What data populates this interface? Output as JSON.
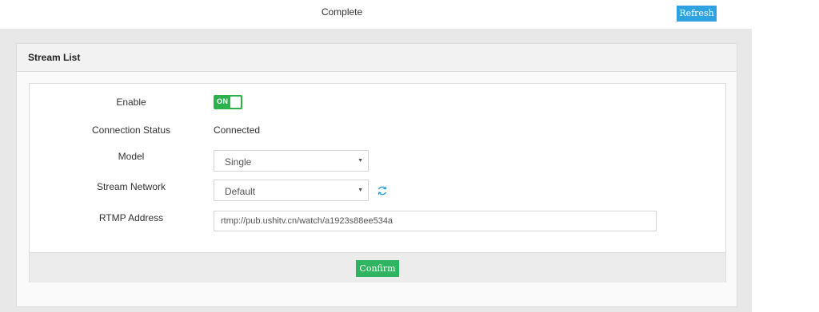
{
  "topbar": {
    "status_text": "Complete",
    "refresh_label": "Refresh"
  },
  "panel": {
    "title": "Stream List",
    "form": {
      "enable": {
        "label": "Enable",
        "toggle_text": "ON",
        "value": true
      },
      "connection_status": {
        "label": "Connection Status",
        "value": "Connected"
      },
      "model": {
        "label": "Model",
        "selected": "Single"
      },
      "stream_network": {
        "label": "Stream Network",
        "selected": "Default",
        "refresh_icon": "refresh-icon"
      },
      "rtmp_address": {
        "label": "RTMP Address",
        "value": "rtmp://pub.ushitv.cn/watch/a1923s88ee534a"
      }
    },
    "confirm_label": "Confirm"
  },
  "colors": {
    "accent_blue": "#2ea3e0",
    "toggle_green": "#2bb24c",
    "confirm_green": "#2fb561",
    "background_gray": "#e8e8e8"
  }
}
